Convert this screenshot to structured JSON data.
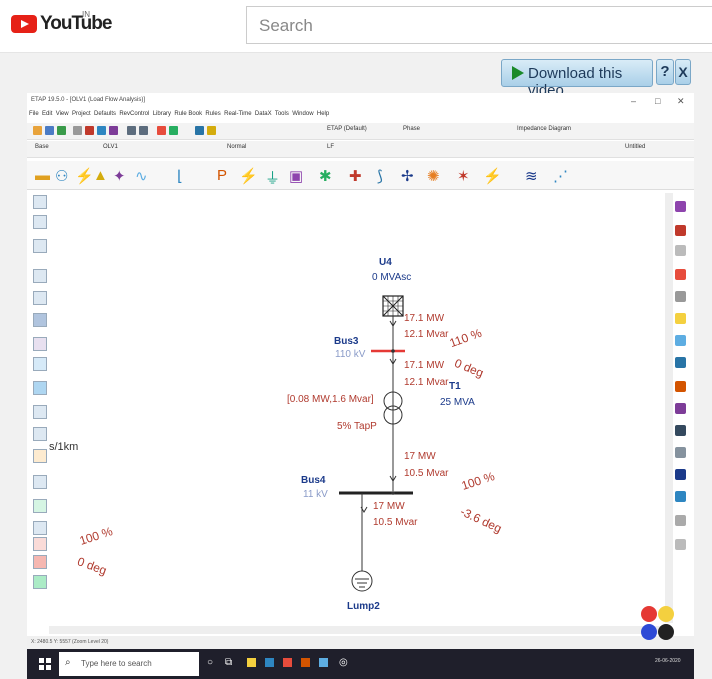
{
  "youtube": {
    "logo_text": "YouTube",
    "country": "IN",
    "search_placeholder": "Search"
  },
  "download_bar": {
    "label": "Download this video",
    "help": "?",
    "close": "X"
  },
  "etap": {
    "title": "ETAP 19.5.0 - [OLV1 (Load Flow Analysis)]",
    "window_controls": [
      "–",
      "□",
      "✕"
    ],
    "menu": [
      "File",
      "Edit",
      "View",
      "Project",
      "Defaults",
      "RevControl",
      "Library",
      "Rule Book",
      "Rules",
      "Real-Time",
      "DataX",
      "Tools",
      "Window",
      "Help"
    ],
    "toolbar_row2": {
      "presentation": "OLV1",
      "config": "Normal",
      "study_case": "Impedance Diagram",
      "scenario": "Untitled",
      "phase": "Phase",
      "base": "Base",
      "revision": "LF"
    }
  },
  "diagram": {
    "source": {
      "name": "U4",
      "rating": "0 MVAsc"
    },
    "bus3": {
      "name": "Bus3",
      "kv": "110 kV",
      "pct": "110 %",
      "deg": "0 deg"
    },
    "flow_upper1": {
      "mw": "17.1 MW",
      "mvar": "12.1 Mvar"
    },
    "flow_upper2": {
      "mw": "17.1 MW",
      "mvar": "12.1 Mvar"
    },
    "transformer": {
      "name": "T1",
      "rating": "25 MVA",
      "loss": "[0.08 MW,1.6 Mvar]",
      "tap": "5% TapP"
    },
    "flow_lower1": {
      "mw": "17 MW",
      "mvar": "10.5 Mvar"
    },
    "bus4": {
      "name": "Bus4",
      "kv": "11 kV",
      "pct": "100 %",
      "deg": "-3.6 deg"
    },
    "flow_lower2": {
      "mw": "17 MW",
      "mvar": "10.5 Mvar"
    },
    "load": {
      "name": "Lump2"
    },
    "left_annot": {
      "pct": "100 %",
      "deg": "0 deg"
    },
    "left_unit": "s/1km"
  },
  "status_bar": {
    "left": "X: 2480.5 Y: 5557 (Zoom Level 20)"
  },
  "taskbar": {
    "search_text": "Type here to search",
    "time": "26-06-2020"
  },
  "colors": {
    "accent_red": "#e62117",
    "diagram_red": "#b03a2e",
    "diagram_blue": "#1b3a8a",
    "bus_red": "#e53935"
  }
}
